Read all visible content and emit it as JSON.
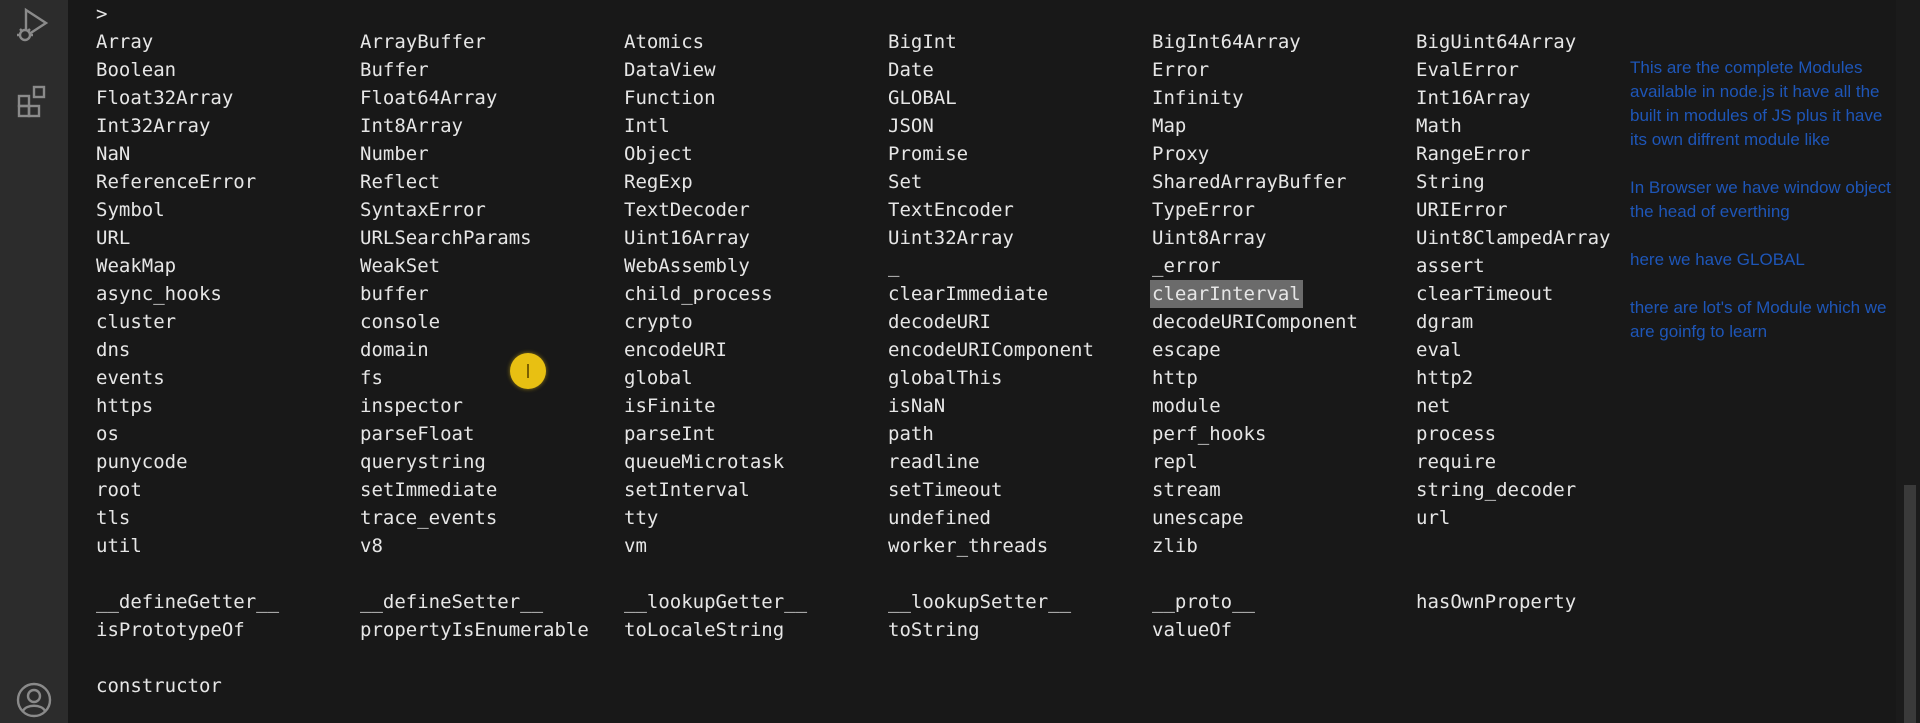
{
  "terminal": {
    "prompt": ">",
    "rows": [
      [
        "Array",
        "ArrayBuffer",
        "Atomics",
        "BigInt",
        "BigInt64Array",
        "BigUint64Array"
      ],
      [
        "Boolean",
        "Buffer",
        "DataView",
        "Date",
        "Error",
        "EvalError"
      ],
      [
        "Float32Array",
        "Float64Array",
        "Function",
        "GLOBAL",
        "Infinity",
        "Int16Array"
      ],
      [
        "Int32Array",
        "Int8Array",
        "Intl",
        "JSON",
        "Map",
        "Math"
      ],
      [
        "NaN",
        "Number",
        "Object",
        "Promise",
        "Proxy",
        "RangeError"
      ],
      [
        "ReferenceError",
        "Reflect",
        "RegExp",
        "Set",
        "SharedArrayBuffer",
        "String"
      ],
      [
        "Symbol",
        "SyntaxError",
        "TextDecoder",
        "TextEncoder",
        "TypeError",
        "URIError"
      ],
      [
        "URL",
        "URLSearchParams",
        "Uint16Array",
        "Uint32Array",
        "Uint8Array",
        "Uint8ClampedArray"
      ],
      [
        "WeakMap",
        "WeakSet",
        "WebAssembly",
        "_",
        "_error",
        "assert"
      ],
      [
        "async_hooks",
        "buffer",
        "child_process",
        "clearImmediate",
        "clearInterval",
        "clearTimeout"
      ],
      [
        "cluster",
        "console",
        "crypto",
        "decodeURI",
        "decodeURIComponent",
        "dgram"
      ],
      [
        "dns",
        "domain",
        "encodeURI",
        "encodeURIComponent",
        "escape",
        "eval"
      ],
      [
        "events",
        "fs",
        "global",
        "globalThis",
        "http",
        "http2"
      ],
      [
        "https",
        "inspector",
        "isFinite",
        "isNaN",
        "module",
        "net"
      ],
      [
        "os",
        "parseFloat",
        "parseInt",
        "path",
        "perf_hooks",
        "process"
      ],
      [
        "punycode",
        "querystring",
        "queueMicrotask",
        "readline",
        "repl",
        "require"
      ],
      [
        "root",
        "setImmediate",
        "setInterval",
        "setTimeout",
        "stream",
        "string_decoder"
      ],
      [
        "tls",
        "trace_events",
        "tty",
        "undefined",
        "unescape",
        "url"
      ],
      [
        "util",
        "v8",
        "vm",
        "worker_threads",
        "zlib",
        ""
      ],
      [],
      [
        "__defineGetter__",
        "__defineSetter__",
        "__lookupGetter__",
        "__lookupSetter__",
        "__proto__",
        "hasOwnProperty"
      ],
      [
        "isPrototypeOf",
        "propertyIsEnumerable",
        "toLocaleString",
        "toString",
        "valueOf",
        ""
      ],
      [],
      [
        "constructor",
        "",
        "",
        "",
        "",
        ""
      ]
    ],
    "highlighted": "clearInterval"
  },
  "notes": [
    "This are the complete Modules  available in node.js it have all the built in modules of JS plus it have its own diffrent module like",
    "In Browser we have window object the head of everthing",
    "here we have GLOBAL",
    "there are lot's of Module which we are goinfg to learn"
  ],
  "icons": {
    "run": "run-debug-icon",
    "extensions": "extensions-icon",
    "account": "account-icon"
  },
  "colors": {
    "note_text": "#1e56b8",
    "terminal_text": "#e6e6e6",
    "cursor_marker": "#e8c012"
  }
}
